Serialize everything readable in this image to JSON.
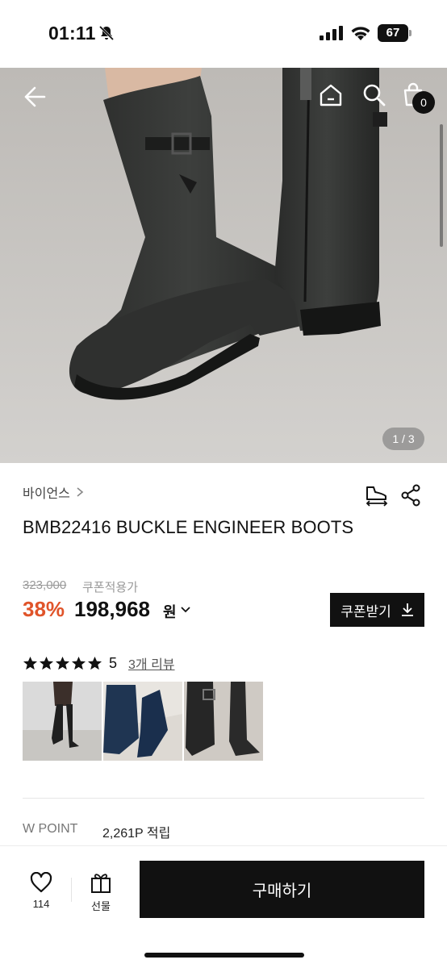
{
  "status_bar": {
    "time": "01:11",
    "battery": "67",
    "icons": [
      "bell-slash-icon",
      "signal-icon",
      "wifi-icon",
      "battery-icon"
    ]
  },
  "hero": {
    "page_indicator": "1 / 3",
    "cart_count": "0",
    "icons": [
      "back-arrow-icon",
      "home-icon",
      "search-icon",
      "shopping-bag-icon"
    ]
  },
  "product": {
    "brand": "바이언스",
    "title": "BMB22416 BUCKLE ENGINEER BOOTS",
    "original_price": "323,000",
    "coupon_note": "쿠폰적용가",
    "discount": "38%",
    "sale_price": "198,968",
    "currency": "원",
    "coupon_button": "쿠폰받기",
    "discount_color": "#e0542a"
  },
  "reviews": {
    "stars": 5,
    "score": "5",
    "link": "3개 리뷰",
    "thumbnails": 3
  },
  "points": {
    "label": "W POINT",
    "value": "2,261P 적립"
  },
  "bottom_bar": {
    "like_count": "114",
    "gift_label": "선물",
    "buy_label": "구매하기"
  }
}
